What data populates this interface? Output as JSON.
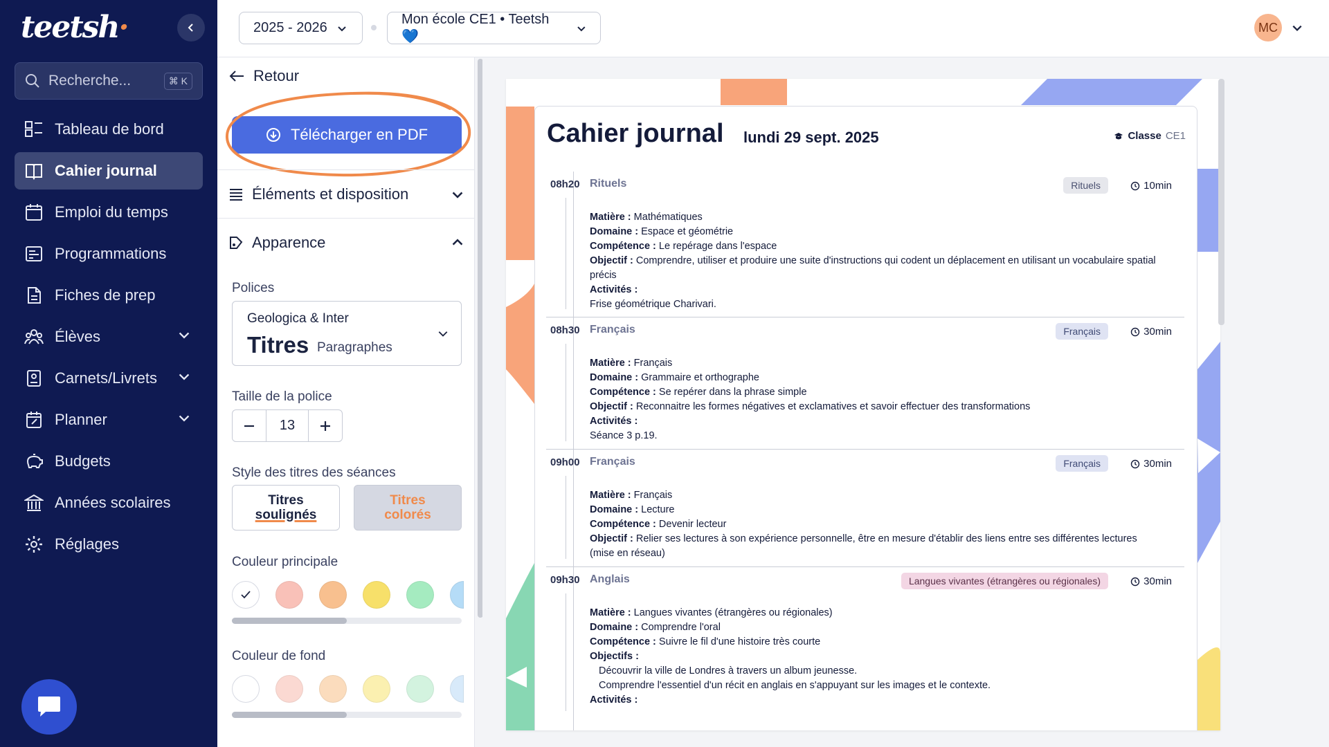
{
  "app": {
    "logo": "teetsh",
    "search_placeholder": "Recherche...",
    "search_shortcut": "⌘ K"
  },
  "nav": [
    {
      "label": "Tableau de bord",
      "icon": "dashboard-icon",
      "active": false,
      "chevron": false
    },
    {
      "label": "Cahier journal",
      "icon": "book-icon",
      "active": true,
      "chevron": false
    },
    {
      "label": "Emploi du temps",
      "icon": "calendar-icon",
      "active": false,
      "chevron": false
    },
    {
      "label": "Programmations",
      "icon": "programming-icon",
      "active": false,
      "chevron": false
    },
    {
      "label": "Fiches de prep",
      "icon": "document-icon",
      "active": false,
      "chevron": false
    },
    {
      "label": "Élèves",
      "icon": "students-icon",
      "active": false,
      "chevron": true
    },
    {
      "label": "Carnets/Livrets",
      "icon": "notebook-icon",
      "active": false,
      "chevron": true
    },
    {
      "label": "Planner",
      "icon": "planner-icon",
      "active": false,
      "chevron": true
    },
    {
      "label": "Budgets",
      "icon": "piggy-bank-icon",
      "active": false,
      "chevron": false
    },
    {
      "label": "Années scolaires",
      "icon": "school-building-icon",
      "active": false,
      "chevron": false
    },
    {
      "label": "Réglages",
      "icon": "gear-icon",
      "active": false,
      "chevron": false
    }
  ],
  "topbar": {
    "year_select": "2025 - 2026",
    "school_select": "Mon école CE1 • Teetsh 💙",
    "avatar": "MC"
  },
  "panel": {
    "back_label": "Retour",
    "pdf_button": "Télécharger en PDF",
    "section_elements": "Éléments et disposition",
    "section_appearance": "Apparence",
    "fonts_label": "Polices",
    "font_family": "Geologica & Inter",
    "font_titles": "Titres",
    "font_paragraphs": "Paragraphes",
    "size_label": "Taille de la police",
    "size_value": "13",
    "title_style_label": "Style des titres des séances",
    "style_underlined_1": "Titres",
    "style_underlined_2": "soulignés",
    "style_colored_1": "Titres",
    "style_colored_2": "colorés",
    "main_color_label": "Couleur principale",
    "main_colors": [
      "#ffffff",
      "#f9c1b8",
      "#f8c08f",
      "#f7e06a",
      "#a5ebc0",
      "#b5dcf7"
    ],
    "bg_color_label": "Couleur de fond",
    "bg_colors": [
      "#ffffff",
      "#fbd9d2",
      "#fbdcbd",
      "#fbf0b0",
      "#d3f3df",
      "#d8eafa"
    ],
    "accent_orange": "#f08a4b",
    "accent_blue": "#4a6be0"
  },
  "doc": {
    "title": "Cahier journal",
    "date": "lundi 29 sept. 2025",
    "class_label": "Classe",
    "class_value": "CE1",
    "sessions": [
      {
        "time": "08h20",
        "name": "Rituels",
        "tag": "Rituels",
        "duration": "10min",
        "lines": [
          {
            "k": "Matière :",
            "v": "Mathématiques"
          },
          {
            "k": "Domaine :",
            "v": "Espace et géométrie"
          },
          {
            "k": "Compétence :",
            "v": "Le repérage dans l'espace"
          },
          {
            "k": "Objectif :",
            "v": "Comprendre, utiliser et produire une suite d'instructions qui codent un déplacement en utilisant un vocabulaire spatial précis"
          },
          {
            "k": "Activités :",
            "v": ""
          },
          {
            "k": "",
            "v": "Frise géométrique Charivari."
          }
        ]
      },
      {
        "time": "08h30",
        "name": "Français",
        "tag": "Français",
        "duration": "30min",
        "lines": [
          {
            "k": "Matière :",
            "v": "Français"
          },
          {
            "k": "Domaine :",
            "v": "Grammaire et orthographe"
          },
          {
            "k": "Compétence :",
            "v": "Se repérer dans la phrase simple"
          },
          {
            "k": "Objectif :",
            "v": "Reconnaitre les formes négatives et exclamatives et savoir effectuer des transformations"
          },
          {
            "k": "Activités :",
            "v": ""
          },
          {
            "k": "",
            "v": "Séance 3 p.19."
          }
        ]
      },
      {
        "time": "09h00",
        "name": "Français",
        "tag": "Français",
        "duration": "30min",
        "lines": [
          {
            "k": "Matière :",
            "v": "Français"
          },
          {
            "k": "Domaine :",
            "v": "Lecture"
          },
          {
            "k": "Compétence :",
            "v": "Devenir lecteur"
          },
          {
            "k": "Objectif :",
            "v": "Relier ses lectures à son expérience personnelle, être en mesure d'établir des liens entre ses différentes lectures (mise en réseau)"
          }
        ]
      },
      {
        "time": "09h30",
        "name": "Anglais",
        "tag": "Langues vivantes (étrangères ou régionales)",
        "duration": "30min",
        "lines": [
          {
            "k": "Matière :",
            "v": "Langues vivantes (étrangères ou régionales)"
          },
          {
            "k": "Domaine :",
            "v": "Comprendre l'oral"
          },
          {
            "k": "Compétence :",
            "v": "Suivre le fil d'une histoire très courte"
          },
          {
            "k": "Objectifs :",
            "v": ""
          },
          {
            "k": "",
            "v": "Découvrir la ville de Londres à travers un album jeunesse.",
            "indent": true
          },
          {
            "k": "",
            "v": "Comprendre l'essentiel d'un récit en anglais en s'appuyant sur les images et le contexte.",
            "indent": true
          },
          {
            "k": "Activités :",
            "v": ""
          }
        ]
      }
    ]
  }
}
